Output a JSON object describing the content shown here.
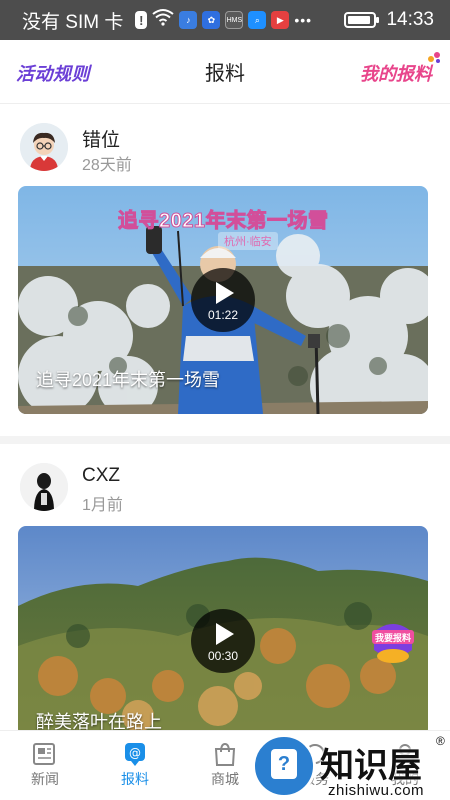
{
  "status_bar": {
    "carrier": "没有 SIM 卡",
    "time": "14:33",
    "battery_level": 0.9,
    "notification_icons": [
      "alert-icon",
      "wifi-icon",
      "music-icon",
      "baidu-icon",
      "hms-icon",
      "search-app-icon",
      "video-app-icon",
      "more-icon"
    ],
    "hms_label": "HMS"
  },
  "header": {
    "left_link": "活动规则",
    "title": "报料",
    "right_link": "我的报料"
  },
  "posts": [
    {
      "username": "错位",
      "time_ago": "28天前",
      "duration": "01:22",
      "caption": "追寻2021年末第一场雪",
      "overlay_title": "追寻2021年末第一场雪",
      "overlay_subtitle": "杭州·临安"
    },
    {
      "username": "CXZ",
      "time_ago": "1月前",
      "duration": "00:30",
      "caption": "醉美落叶在路上",
      "badge_text": "我要报料"
    }
  ],
  "tabs": [
    {
      "label": "新闻",
      "icon": "news-icon",
      "active": false
    },
    {
      "label": "报料",
      "icon": "report-icon",
      "active": true
    },
    {
      "label": "商城",
      "icon": "shop-icon",
      "active": false
    },
    {
      "label": "服务",
      "icon": "service-icon",
      "active": false
    },
    {
      "label": "我的",
      "icon": "profile-icon",
      "active": false
    }
  ],
  "watermark": {
    "text": "知识屋",
    "reg": "®",
    "url": "zhishiwu.com"
  },
  "colors": {
    "accent": "#1a8fe8",
    "status_bar": "#4d4d4d",
    "rules_link": "#6b3fd6",
    "my_report_link": "#e8458b"
  }
}
